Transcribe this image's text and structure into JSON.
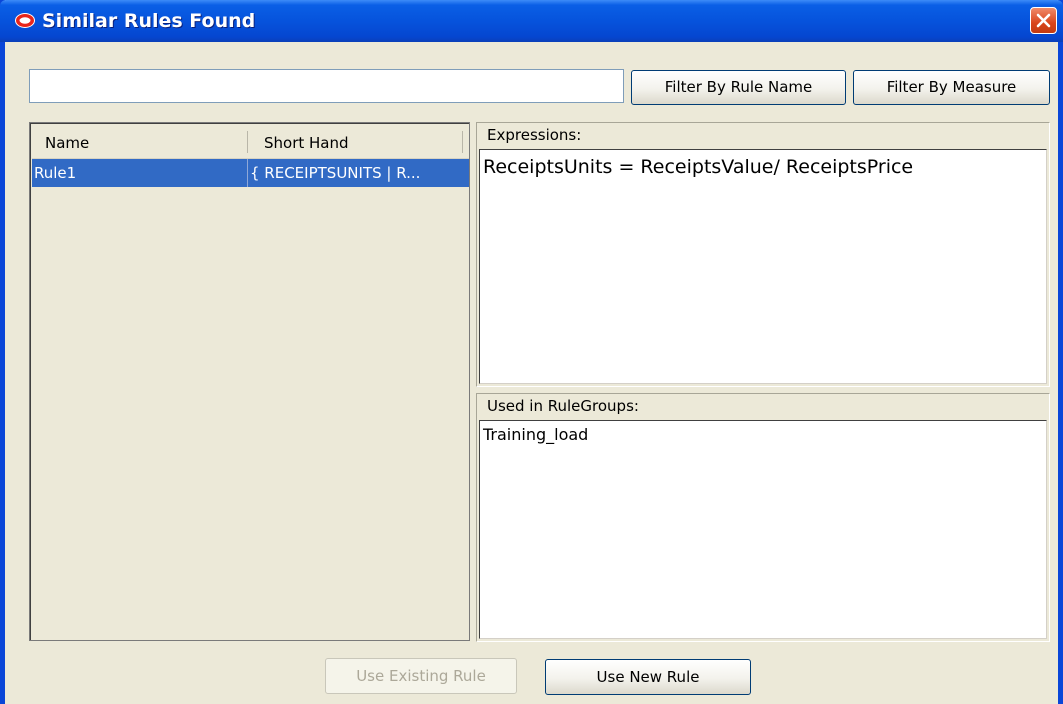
{
  "window": {
    "title": "Similar Rules Found",
    "colors": {
      "titlebar": "#0653dc",
      "close_button": "#d9451c",
      "selection": "#316ac5",
      "background": "#ece9d8"
    }
  },
  "filter": {
    "input_value": "",
    "filter_by_rule_name_label": "Filter By Rule Name",
    "filter_by_measure_label": "Filter By Measure"
  },
  "rules_table": {
    "columns": [
      "Name",
      "Short Hand"
    ],
    "rows": [
      {
        "name": "Rule1",
        "short_hand": "{ RECEIPTSUNITS | R...",
        "selected": true
      }
    ]
  },
  "expressions": {
    "label": "Expressions:",
    "text": "ReceiptsUnits = ReceiptsValue/ ReceiptsPrice"
  },
  "rule_groups": {
    "label": "Used in RuleGroups:",
    "text": "Training_load"
  },
  "footer": {
    "use_existing_label": "Use Existing Rule",
    "use_existing_enabled": false,
    "use_new_label": "Use New Rule"
  },
  "icons": {
    "app": "oracle-logo-icon",
    "close": "close-icon"
  }
}
